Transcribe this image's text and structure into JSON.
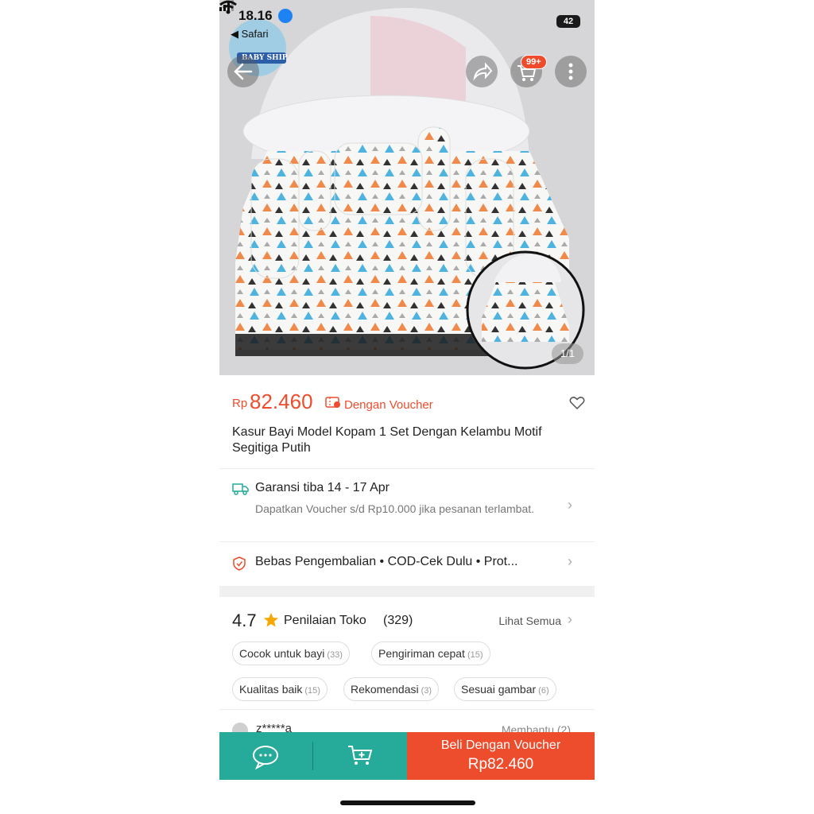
{
  "status_bar": {
    "time": "18.16",
    "back_app": "◀ Safari",
    "battery": "42"
  },
  "shop_logo_text": "BABY SHIP",
  "header": {
    "cart_badge": "99+"
  },
  "gallery": {
    "counter": "1/1"
  },
  "price": {
    "currency": "Rp",
    "amount": "82.460",
    "voucher_label": "Dengan Voucher"
  },
  "product": {
    "title": "Kasur Bayi Model Kopam 1 Set Dengan Kelambu Motif Segitiga Putih"
  },
  "shipping": {
    "title": "Garansi tiba 14 - 17 Apr",
    "subtitle": "Dapatkan Voucher s/d Rp10.000 jika pesanan terlambat."
  },
  "policy": {
    "text": "Bebas Pengembalian  •  COD-Cek Dulu  •  Prot..."
  },
  "rating": {
    "score": "4.7",
    "label": "Penilaian Toko",
    "count": "(329)",
    "see_all": "Lihat Semua",
    "tags": [
      {
        "label": "Cocok untuk bayi",
        "count": "(33)"
      },
      {
        "label": "Pengiriman cepat",
        "count": "(15)"
      },
      {
        "label": "Kualitas baik",
        "count": "(15)"
      },
      {
        "label": "Rekomendasi",
        "count": "(3)"
      },
      {
        "label": "Sesuai gambar",
        "count": "(6)"
      }
    ]
  },
  "review": {
    "user": "z*****a",
    "helpful": "Membantu (2)"
  },
  "bottom_bar": {
    "buy_label": "Beli Dengan Voucher",
    "buy_price": "Rp82.460"
  },
  "colors": {
    "accent": "#ee4d2d",
    "teal": "#26aa99"
  }
}
